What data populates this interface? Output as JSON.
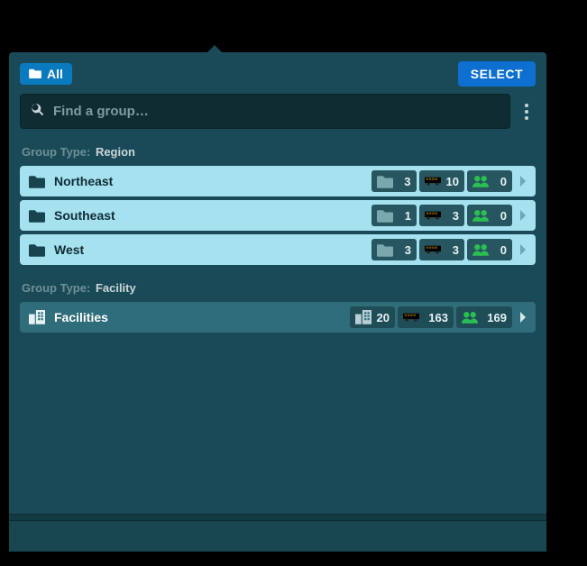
{
  "header": {
    "all_chip": "All",
    "select_btn": "SELECT"
  },
  "search": {
    "placeholder": "Find a group…",
    "value": ""
  },
  "section_label_prefix": "Group Type:",
  "sections": [
    {
      "label": "Region",
      "style": "light",
      "lead": "folder",
      "items": [
        {
          "name": "Northeast",
          "badges": [
            {
              "icon": "folder",
              "value": 3
            },
            {
              "icon": "bus",
              "value": 10
            },
            {
              "icon": "people",
              "value": 0
            }
          ]
        },
        {
          "name": "Southeast",
          "badges": [
            {
              "icon": "folder",
              "value": 1
            },
            {
              "icon": "bus",
              "value": 3
            },
            {
              "icon": "people",
              "value": 0
            }
          ]
        },
        {
          "name": "West",
          "badges": [
            {
              "icon": "folder",
              "value": 3
            },
            {
              "icon": "bus",
              "value": 3
            },
            {
              "icon": "people",
              "value": 0
            }
          ]
        }
      ]
    },
    {
      "label": "Facility",
      "style": "dark",
      "lead": "building",
      "items": [
        {
          "name": "Facilities",
          "badges": [
            {
              "icon": "building",
              "value": 20
            },
            {
              "icon": "bus",
              "value": 163
            },
            {
              "icon": "people",
              "value": 169
            }
          ]
        }
      ]
    }
  ]
}
